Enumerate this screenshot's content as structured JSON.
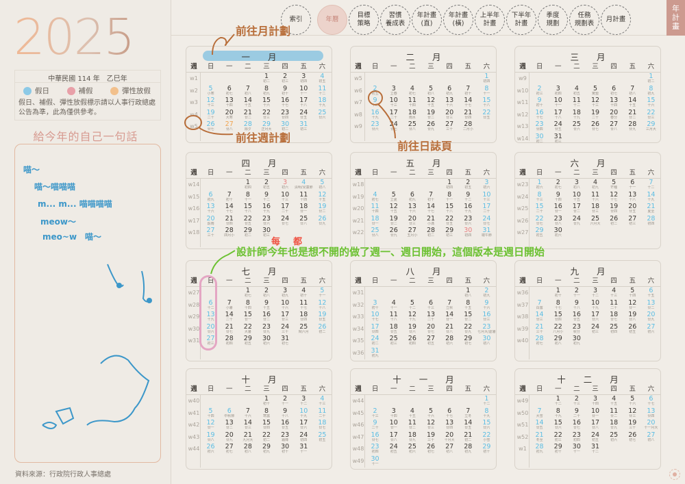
{
  "left": {
    "year": "2025",
    "roc": "中華民國 114 年　乙巳年",
    "legend": [
      {
        "label": "假日",
        "color": "#8cc9e6"
      },
      {
        "label": "補假",
        "color": "#e8a0a8"
      },
      {
        "label": "彈性放假",
        "color": "#f2c08c"
      }
    ],
    "note": "假日、補假、彈性放假標示請以人事行政總處公告為準，此為僅供參考。",
    "wish_title": "給今年的自己一句話",
    "wish_lines": [
      "喵～",
      "喵～喵喵喵",
      "m... m... 喵喵喵喵",
      "meow～",
      "meo~w　喵～"
    ],
    "source": "資料來源：行政院行政人事總處"
  },
  "nav": {
    "tabs": [
      {
        "label": "索引"
      },
      {
        "label": "年曆",
        "active": true
      },
      {
        "label": "目標\n策略"
      },
      {
        "label": "習慣\n養成表"
      },
      {
        "label": "年計畫\n(直)"
      },
      {
        "label": "年計畫\n(橫)"
      },
      {
        "label": "上半年\n計畫"
      },
      {
        "label": "下半年\n計畫"
      },
      {
        "label": "季度\n規劃"
      },
      {
        "label": "任務\n規劃表"
      },
      {
        "label": "月計畫"
      }
    ],
    "side_tab": "年\n計\n畫"
  },
  "calendar": {
    "weekdays": [
      "週",
      "日",
      "一",
      "二",
      "三",
      "四",
      "五",
      "六"
    ],
    "months": [
      {
        "title": "一月",
        "startDow": 3,
        "days": 31,
        "startWeek": 1,
        "lunar": [
          "初二",
          "初三",
          "初四",
          "初五",
          "小寒",
          "初七",
          "初八",
          "初九",
          "初十",
          "十一",
          "十二",
          "十三",
          "十四",
          "十五",
          "十六",
          "十七",
          "十八",
          "十九",
          "二十",
          "大寒",
          "廿二",
          "廿三",
          "廿四",
          "廿五",
          "廿六",
          "廿七",
          "廿八",
          "除夕",
          "正月大",
          "初二",
          "初三"
        ],
        "special": {
          "27": "flex",
          "28": "hol",
          "29": "hol",
          "30": "hol",
          "31": "hol"
        }
      },
      {
        "title": "二月",
        "startDow": 6,
        "days": 28,
        "startWeek": 5,
        "lunar": [
          "初四",
          "初五",
          "立春",
          "初七",
          "初八",
          "初九",
          "初十",
          "十一",
          "十二",
          "十三",
          "十四",
          "十五",
          "十六",
          "十七",
          "十八",
          "十九",
          "二十",
          "雨水",
          "廿二",
          "廿三",
          "廿四",
          "廿五",
          "廿六",
          "廿七",
          "廿八",
          "廿九",
          "三十",
          "二月小"
        ],
        "special": {}
      },
      {
        "title": "三月",
        "startDow": 6,
        "days": 31,
        "startWeek": 9,
        "lunar": [
          "初二",
          "初三",
          "初四",
          "初五",
          "驚蟄",
          "初七",
          "初八",
          "初九",
          "初十",
          "十一",
          "十二",
          "十三",
          "十四",
          "十五",
          "十六",
          "十七",
          "十八",
          "十九",
          "二十",
          "春分",
          "廿二",
          "廿三",
          "廿四",
          "廿五",
          "廿六",
          "廿七",
          "廿八",
          "廿九",
          "三月大",
          "初二",
          "初三"
        ],
        "special": {}
      },
      {
        "title": "四月",
        "startDow": 2,
        "days": 30,
        "startWeek": 14,
        "lunar": [
          "初四",
          "初五",
          "初六",
          "清明/兒童節",
          "初八",
          "初九",
          "初十",
          "十一",
          "十二",
          "十三",
          "十四",
          "十五",
          "十六",
          "十七",
          "十八",
          "十九",
          "二十",
          "廿一",
          "廿二",
          "穀雨",
          "廿四",
          "廿五",
          "廿六",
          "廿七",
          "廿八",
          "廿九",
          "三十",
          "四月小",
          "初二",
          "初三"
        ],
        "special": {
          "3": "make",
          "4": "hol"
        }
      },
      {
        "title": "五月",
        "startDow": 4,
        "days": 31,
        "startWeek": 18,
        "lunar": [
          "初四",
          "初五",
          "初六",
          "初七",
          "立夏",
          "初九",
          "初十",
          "十一",
          "十二",
          "十三",
          "十四",
          "十五",
          "十六",
          "十七",
          "十八",
          "十九",
          "二十",
          "廿一",
          "廿二",
          "廿三",
          "小滿",
          "廿五",
          "廿六",
          "廿七",
          "廿八",
          "廿九",
          "五月小",
          "初二",
          "初三",
          "初四",
          "端午節"
        ],
        "special": {
          "30": "make",
          "31": "hol"
        }
      },
      {
        "title": "六月",
        "startDow": 0,
        "days": 30,
        "startWeek": 23,
        "lunar": [
          "初六",
          "初七",
          "初八",
          "初九",
          "芒種",
          "十一",
          "十二",
          "十三",
          "十四",
          "十五",
          "十六",
          "十七",
          "十八",
          "十九",
          "二十",
          "廿一",
          "廿二",
          "廿三",
          "廿四",
          "廿五",
          "夏至",
          "廿七",
          "廿八",
          "廿九",
          "六月大",
          "初二",
          "初三",
          "初四",
          "初五",
          "初六"
        ],
        "special": {}
      },
      {
        "title": "七月",
        "startDow": 2,
        "days": 31,
        "startWeek": 27,
        "lunar": [
          "初七",
          "初八",
          "初九",
          "初十",
          "十一",
          "十二",
          "小暑",
          "十四",
          "十五",
          "十六",
          "十七",
          "十八",
          "十九",
          "二十",
          "廿一",
          "廿二",
          "廿三",
          "廿四",
          "廿五",
          "廿六",
          "廿七",
          "大暑",
          "廿九",
          "三十",
          "閏六月",
          "初二",
          "初三",
          "初四",
          "初五",
          "初六",
          "初七"
        ],
        "special": {}
      },
      {
        "title": "八月",
        "startDow": 5,
        "days": 31,
        "startWeek": 31,
        "lunar": [
          "初八",
          "初九",
          "初十",
          "十一",
          "十二",
          "十三",
          "立秋",
          "十五",
          "十六",
          "十七",
          "十八",
          "十九",
          "二十",
          "廿一",
          "廿二",
          "廿三",
          "廿四",
          "廿五",
          "廿六",
          "廿七",
          "廿八",
          "廿九",
          "七月大/處暑",
          "初二",
          "初三",
          "初四",
          "初五",
          "初六",
          "初七",
          "初八",
          "初九"
        ],
        "special": {}
      },
      {
        "title": "九月",
        "startDow": 1,
        "days": 30,
        "startWeek": 36,
        "lunar": [
          "初十",
          "十一",
          "十二",
          "十三",
          "十四",
          "十五",
          "白露",
          "十七",
          "十八",
          "十九",
          "二十",
          "廿一",
          "廿二",
          "廿三",
          "廿四",
          "廿五",
          "廿六",
          "廿七",
          "廿八",
          "廿九",
          "三十",
          "八月小",
          "秋分",
          "初三",
          "初四",
          "初五",
          "初六",
          "初七",
          "初八",
          "初九"
        ],
        "special": {}
      },
      {
        "title": "十月",
        "startDow": 3,
        "days": 31,
        "startWeek": 40,
        "lunar": [
          "初十",
          "十一",
          "十二",
          "十三",
          "十四",
          "中秋節",
          "十六",
          "寒露",
          "十八",
          "十九",
          "二十",
          "廿一",
          "廿二",
          "廿三",
          "廿四",
          "廿五",
          "廿六",
          "廿七",
          "廿八",
          "廿九",
          "九月大",
          "初二",
          "霜降",
          "初四",
          "初五",
          "初六",
          "初七",
          "初八",
          "初九",
          "初十",
          "十一"
        ],
        "special": {
          "6": "hol",
          "10": "hol"
        }
      },
      {
        "title": "十一月",
        "startDow": 6,
        "days": 30,
        "startWeek": 44,
        "lunar": [
          "十二",
          "十三",
          "十四",
          "十五",
          "十六",
          "十七",
          "立冬",
          "十九",
          "二十",
          "廿一",
          "廿二",
          "廿三",
          "廿四",
          "廿五",
          "廿六",
          "廿七",
          "廿八",
          "廿九",
          "三十",
          "十月大",
          "初二",
          "小雪",
          "初四",
          "初五",
          "初六",
          "初七",
          "初八",
          "初九",
          "初十",
          "十一"
        ],
        "special": {}
      },
      {
        "title": "十二月",
        "startDow": 1,
        "days": 31,
        "startWeek": 49,
        "lastWeekLabel": "w1",
        "lunar": [
          "十二",
          "十三",
          "十四",
          "十五",
          "十六",
          "十七",
          "大雪",
          "十九",
          "二十",
          "廿一",
          "廿二",
          "廿三",
          "廿四",
          "廿五",
          "廿六",
          "廿七",
          "廿八",
          "廿九",
          "三十",
          "十一月大",
          "冬至",
          "初三",
          "初四",
          "初五",
          "初六",
          "初七",
          "初八",
          "初九",
          "初十",
          "十一",
          "十二"
        ],
        "special": {}
      }
    ]
  },
  "annotations": {
    "go_month": "前往月計劃",
    "go_week": "前往週計劃",
    "go_day": "前往日誌頁",
    "designer_note": "設計師今年也是想不開的做了週一、週日開始，這個版本是週日開始",
    "correction_1": "每",
    "correction_2": "都"
  },
  "colors": {
    "holiday": "#5bbde3",
    "makeup": "#e88080",
    "flex": "#f0a450",
    "accent": "#cc9a8f"
  }
}
